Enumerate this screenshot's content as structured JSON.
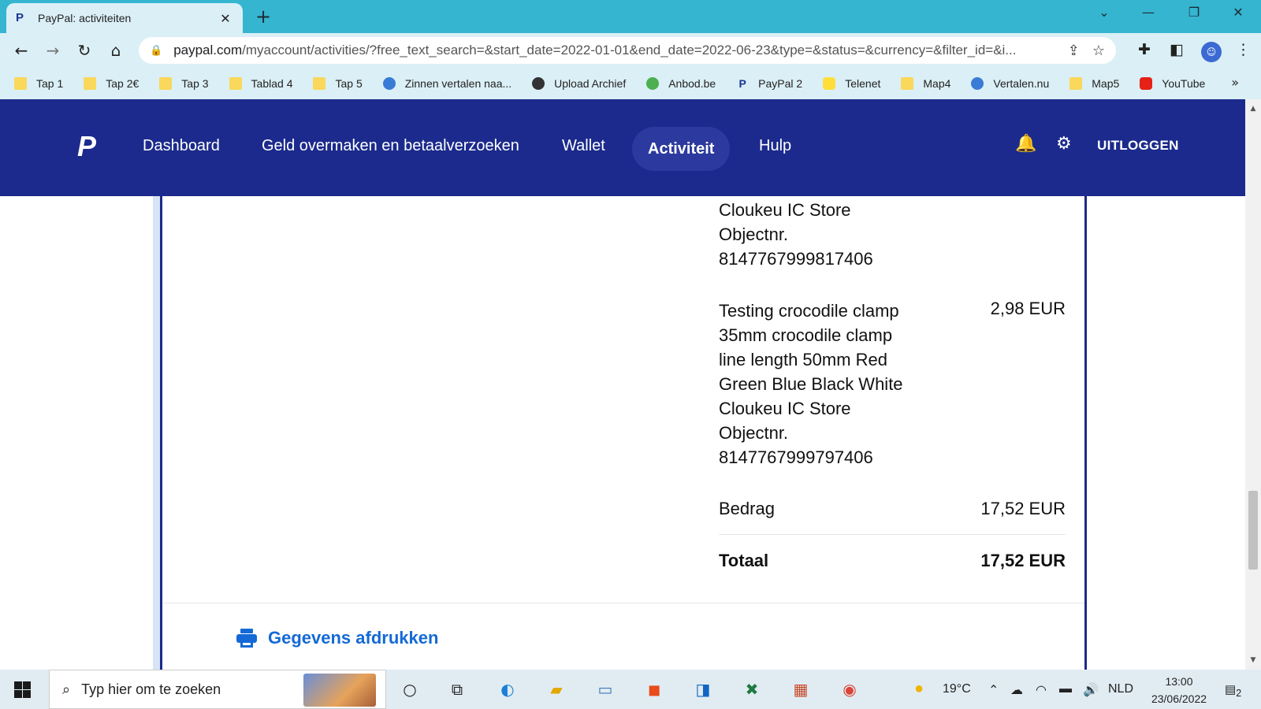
{
  "browser": {
    "tab_title": "PayPal: activiteiten",
    "tab_close": "✕",
    "new_tab": "+",
    "url_domain": "paypal.com",
    "url_path": "/myaccount/activities/?free_text_search=&start_date=2022-01-01&end_date=2022-06-23&type=&status=&currency=&filter_id=&i...",
    "bookmarks": [
      {
        "label": "Tap 1",
        "icon": "folder"
      },
      {
        "label": "Tap 2€",
        "icon": "folder"
      },
      {
        "label": "Tap 3",
        "icon": "folder"
      },
      {
        "label": "Tablad 4",
        "icon": "folder"
      },
      {
        "label": "Tap 5",
        "icon": "folder"
      },
      {
        "label": "Zinnen vertalen naa...",
        "icon": "circle"
      },
      {
        "label": "Upload Archief",
        "icon": "dark"
      },
      {
        "label": "Anbod.be",
        "icon": "green"
      },
      {
        "label": "PayPal 2",
        "icon": "pp"
      },
      {
        "label": "Telenet",
        "icon": "tel"
      },
      {
        "label": "Map4",
        "icon": "folder"
      },
      {
        "label": "Vertalen.nu",
        "icon": "circle"
      },
      {
        "label": "Map5",
        "icon": "folder"
      },
      {
        "label": "YouTube",
        "icon": "yt"
      }
    ],
    "bookmarks_more": "»"
  },
  "paypal": {
    "logo": "P",
    "nav": {
      "dashboard": "Dashboard",
      "transfer": "Geld overmaken en betaalverzoeken",
      "wallet": "Wallet",
      "activity": "Activiteit",
      "help": "Hulp"
    },
    "logout": "UITLOGGEN"
  },
  "details": {
    "item1_lines": [
      "Cloukeu IC Store",
      "Objectnr.",
      "8147767999817406"
    ],
    "item2_lines": [
      "Testing crocodile clamp",
      "35mm crocodile clamp",
      "line length 50mm Red",
      "Green Blue Black White",
      "Cloukeu IC Store",
      "Objectnr.",
      "8147767999797406"
    ],
    "item2_amount": "2,98 EUR",
    "amount_label": "Bedrag",
    "amount_value": "17,52 EUR",
    "total_label": "Totaal",
    "total_value": "17,52 EUR",
    "print_label": "Gegevens afdrukken"
  },
  "taskbar": {
    "search_placeholder": "Typ hier om te zoeken",
    "weather": "19°C",
    "language": "NLD",
    "time": "13:00",
    "date": "23/06/2022",
    "notifications": "2"
  }
}
